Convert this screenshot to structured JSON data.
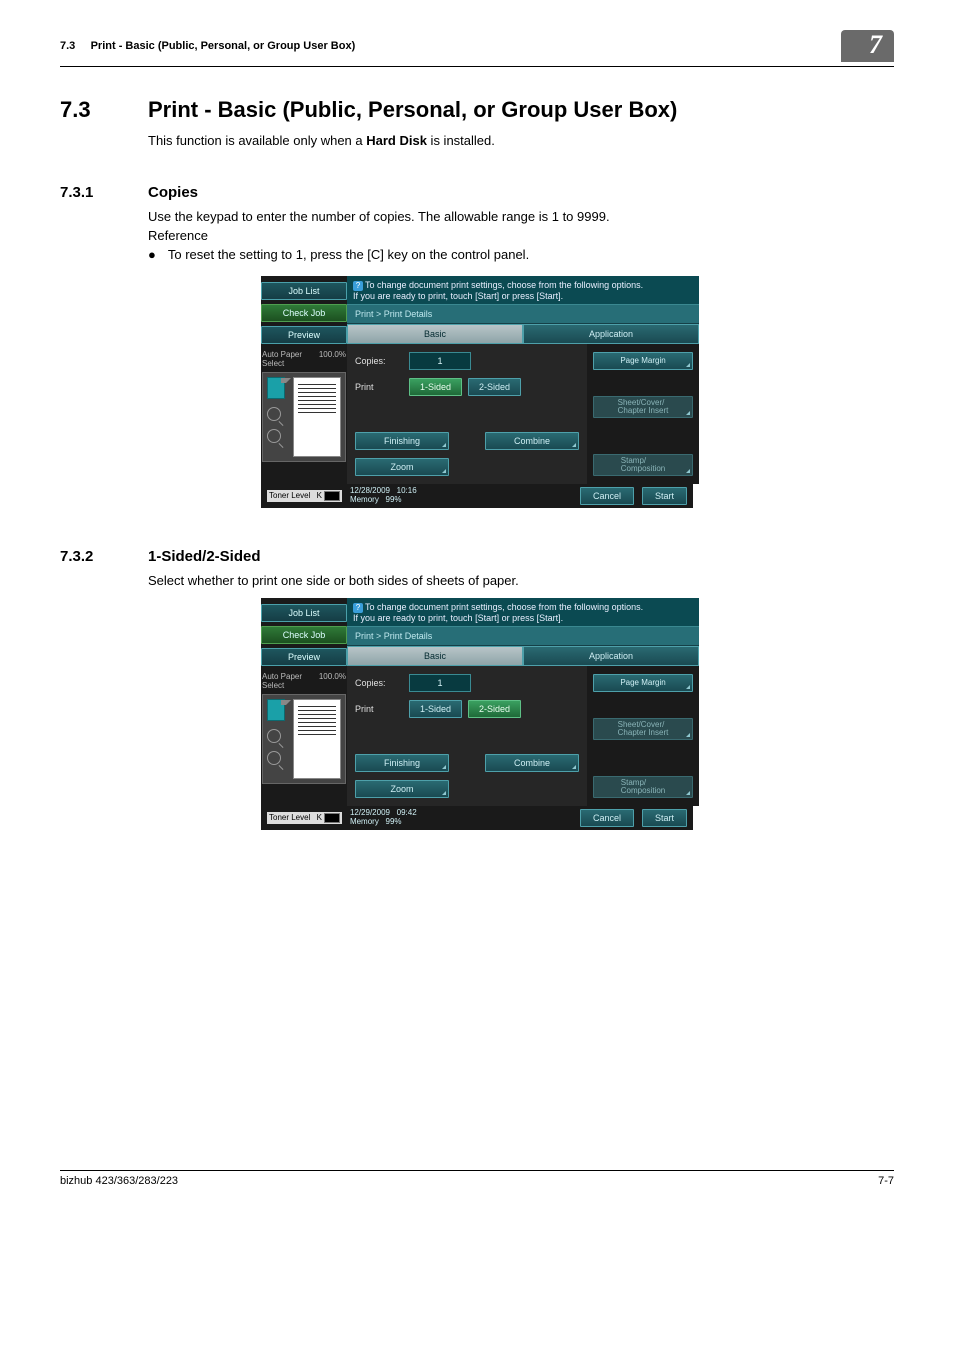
{
  "header": {
    "section_num": "7.3",
    "section_title": "Print - Basic (Public, Personal, or Group User Box)",
    "chapter_tab": "7"
  },
  "h1": {
    "num": "7.3",
    "title": "Print - Basic (Public, Personal, or Group User Box)"
  },
  "intro_a": "This function is available only when a ",
  "intro_bold": "Hard Disk",
  "intro_b": " is installed.",
  "section1": {
    "num": "7.3.1",
    "title": "Copies",
    "p1": "Use the keypad to enter the number of copies. The allowable range is 1 to 9999.",
    "ref": "Reference",
    "bullet": "To reset the setting to 1, press the [C] key on the control panel."
  },
  "section2": {
    "num": "7.3.2",
    "title": "1-Sided/2-Sided",
    "p1": "Select whether to print one side or both sides of sheets of paper."
  },
  "panel1": {
    "side": {
      "job_list": "Job List",
      "check_job": "Check Job",
      "preview": "Preview",
      "auto_paper": "Auto Paper Select",
      "percent": "100.0%"
    },
    "hint1": "To change document print settings, choose from the following options.",
    "hint2": "If you are ready to print, touch [Start] or press [Start].",
    "breadcrumb": "Print > Print Details",
    "tabs": {
      "basic": "Basic",
      "application": "Application"
    },
    "fields": {
      "copies_label": "Copies:",
      "copies_value": "1",
      "print_label": "Print",
      "onesided": "1-Sided",
      "twosided": "2-Sided",
      "finishing": "Finishing",
      "combine": "Combine",
      "zoom": "Zoom"
    },
    "app_btns": {
      "page_margin": "Page Margin",
      "sheet_cover": "Sheet/Cover/\nChapter Insert",
      "stamp": "Stamp/\nComposition"
    },
    "footer": {
      "toner": "Toner Level",
      "toner_k": "K",
      "date": "12/28/2009",
      "time": "10:16",
      "memory_label": "Memory",
      "memory_val": "99%",
      "cancel": "Cancel",
      "start": "Start"
    },
    "selected_sided": "1"
  },
  "panel2": {
    "side": {
      "job_list": "Job List",
      "check_job": "Check Job",
      "preview": "Preview",
      "auto_paper": "Auto Paper Select",
      "percent": "100.0%"
    },
    "hint1": "To change document print settings, choose from the following options.",
    "hint2": "If you are ready to print, touch [Start] or press [Start].",
    "breadcrumb": "Print > Print Details",
    "tabs": {
      "basic": "Basic",
      "application": "Application"
    },
    "fields": {
      "copies_label": "Copies:",
      "copies_value": "1",
      "print_label": "Print",
      "onesided": "1-Sided",
      "twosided": "2-Sided",
      "finishing": "Finishing",
      "combine": "Combine",
      "zoom": "Zoom"
    },
    "app_btns": {
      "page_margin": "Page Margin",
      "sheet_cover": "Sheet/Cover/\nChapter Insert",
      "stamp": "Stamp/\nComposition"
    },
    "footer": {
      "toner": "Toner Level",
      "toner_k": "K",
      "date": "12/29/2009",
      "time": "09:42",
      "memory_label": "Memory",
      "memory_val": "99%",
      "cancel": "Cancel",
      "start": "Start"
    },
    "selected_sided": "2"
  },
  "footer": {
    "left": "bizhub 423/363/283/223",
    "right": "7-7"
  }
}
